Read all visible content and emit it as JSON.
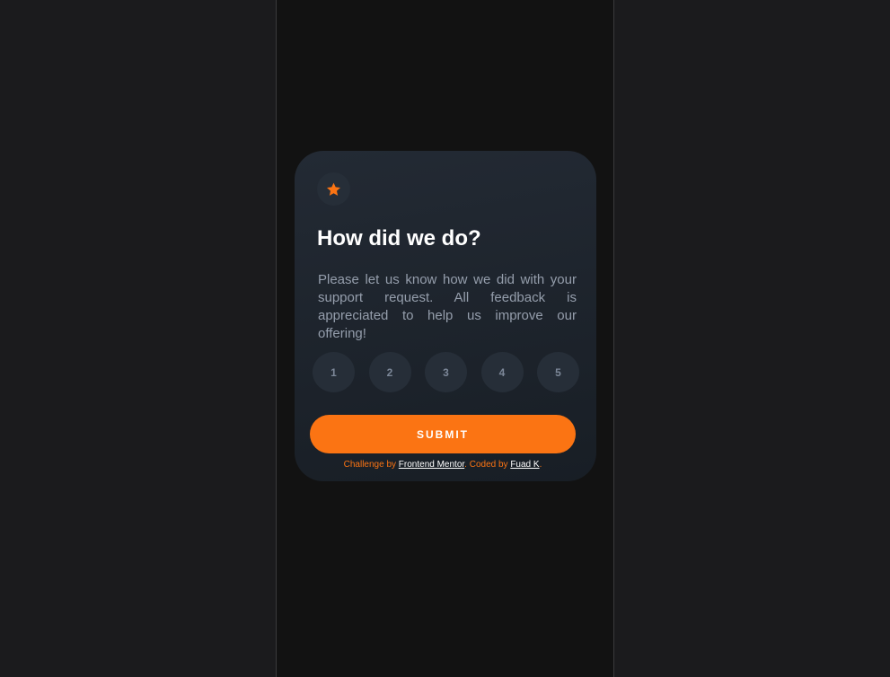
{
  "card": {
    "icon": "star-icon",
    "title": "How did we do?",
    "description": "Please let us know how we did with your support request. All feedback is appreciated to help us improve our offering!",
    "ratings": [
      "1",
      "2",
      "3",
      "4",
      "5"
    ],
    "submit_label": "SUBMIT"
  },
  "attribution": {
    "prefix": "Challenge by",
    "link1": "Frontend Mentor",
    "middle": ". Coded by",
    "link2": "Fuad K",
    "suffix": "."
  },
  "colors": {
    "page_bg": "#1b1b1d",
    "viewport_bg": "#121212",
    "card_bg_top": "#232a34",
    "card_bg_bottom": "#181e25",
    "accent": "#fb7413",
    "rating_bg": "#262e38",
    "text_muted": "#959eac",
    "heading": "#ffffff"
  }
}
